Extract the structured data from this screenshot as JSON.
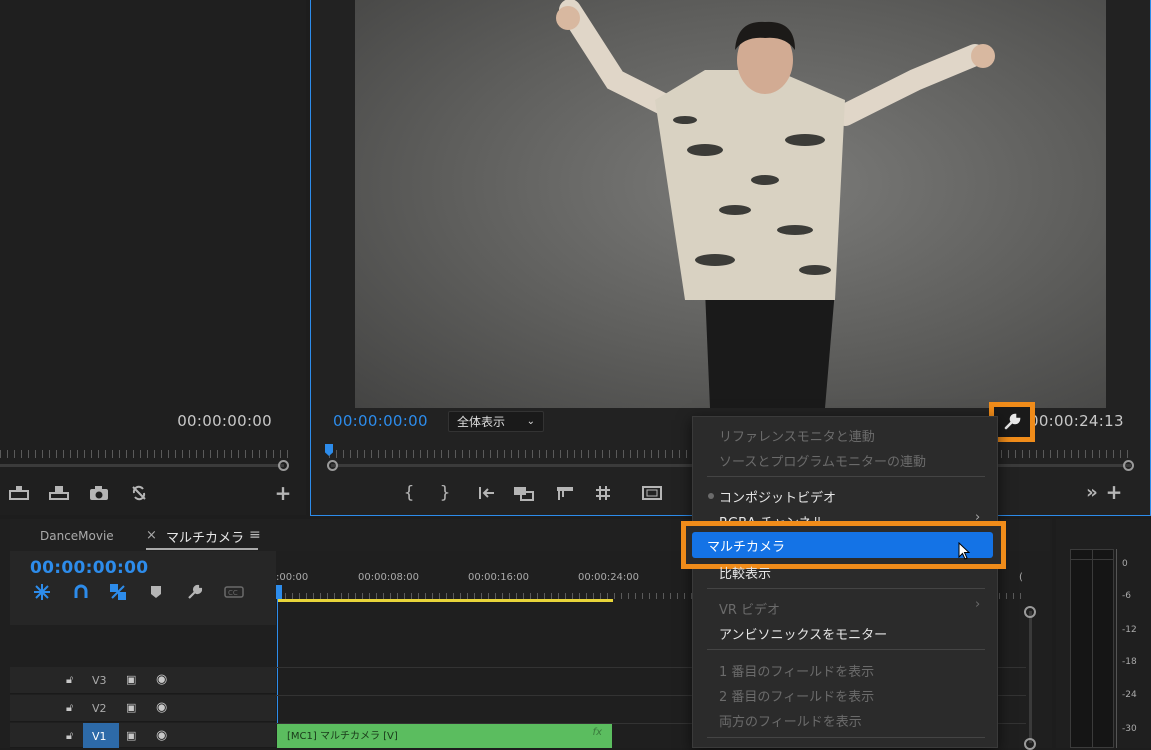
{
  "source_monitor": {
    "timecode": "00:00:00:00"
  },
  "program_monitor": {
    "timecode_in": "00:00:00:00",
    "zoom": "全体表示",
    "timecode_duration": "00:00:24:13"
  },
  "context_menu": {
    "items": [
      {
        "label": "リファレンスモニタと連動",
        "disabled": true
      },
      {
        "label": "ソースとプログラムモニターの連動",
        "disabled": true
      },
      {
        "label": "コンポジットビデオ",
        "checked": true
      },
      {
        "label": "RGBA チャンネル",
        "submenu": true
      },
      {
        "label": "マルチカメラ",
        "highlighted": true
      },
      {
        "label": "比較表示"
      },
      {
        "label": "VR ビデオ",
        "submenu": true,
        "disabled": true
      },
      {
        "label": "アンビソニックスをモニター"
      },
      {
        "label": "1 番目のフィールドを表示",
        "disabled": true
      },
      {
        "label": "2 番目のフィールドを表示",
        "disabled": true
      },
      {
        "label": "両方のフィールドを表示",
        "disabled": true
      }
    ]
  },
  "timeline": {
    "tabs": [
      {
        "label": "DanceMovie"
      },
      {
        "label": "マルチカメラ"
      }
    ],
    "close_glyph": "×",
    "menu_glyph": "≡",
    "timecode": "00:00:00:00",
    "ruler_ticks": [
      ":00:00",
      "00:00:08:00",
      "00:00:16:00",
      "00:00:24:00",
      "("
    ],
    "tracks": [
      {
        "name": "V3"
      },
      {
        "name": "V2"
      },
      {
        "name": "V1"
      }
    ],
    "clip_label": "[MC1] マルチカメラ [V]",
    "fx_label": "fx"
  },
  "audio_meter": {
    "ticks": [
      "0",
      "-6",
      "-12",
      "-18",
      "-24",
      "-30"
    ]
  },
  "colors": {
    "accent": "#2d8ceb",
    "highlight": "#f08c1a",
    "clip": "#5bbd5f",
    "menu_selected": "#1473e6"
  },
  "icons": [
    "lift-icon",
    "extract-icon",
    "export-frame-icon",
    "comparison-icon",
    "add-button-icon",
    "mark-in-icon",
    "mark-out-icon",
    "go-to-in-icon",
    "insert-icon",
    "overwrite-icon",
    "trim-icon",
    "safe-margins-icon",
    "wrench-icon",
    "more-icon",
    "snap-icon",
    "linked-selection-icon",
    "add-marker-icon",
    "captions-icon",
    "lock-icon",
    "sync-icon",
    "eye-icon"
  ]
}
